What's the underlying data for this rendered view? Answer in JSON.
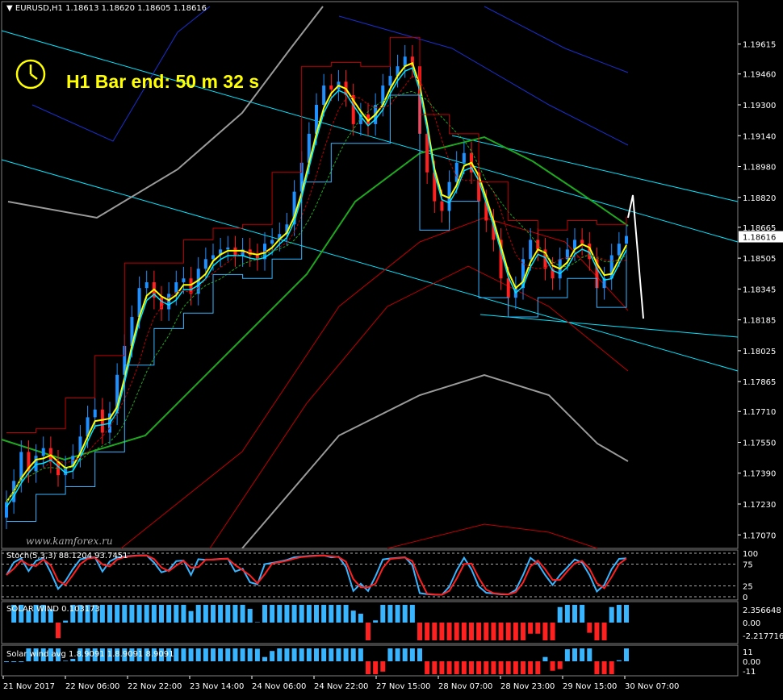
{
  "header": {
    "symbol": "EURUSD,H1",
    "ohlc": "1.18613 1.18620 1.18605 1.18616",
    "timer_text": "H1 Bar end: 50 m 32 s",
    "watermark": "www.kamforex.ru"
  },
  "indicators": {
    "stoch_label": "Stoch(5,3,3) 88.1204 93.7451",
    "solar_label": "SOLAR WIND 0.103173",
    "solar_avg_label": "Solar wind avg 1.8.9091 1.8.9091 8.9091"
  },
  "colors": {
    "background": "#000000",
    "bull_candle": "#1e90ff",
    "bear_candle": "#ff2020",
    "yellow": "#ffff00",
    "cyan": "#00e5ff",
    "green": "#1fa81f",
    "red": "#c00000",
    "gray": "#9a9a9a",
    "navy": "#1a2fcc"
  },
  "chart_data": {
    "type": "line",
    "price_axis": {
      "ticks": [
        "1.19615",
        "1.19460",
        "1.19300",
        "1.19140",
        "1.18980",
        "1.18820",
        "1.18665",
        "1.18505",
        "1.18345",
        "1.18185",
        "1.18025",
        "1.17865",
        "1.17710",
        "1.17550",
        "1.17390",
        "1.17230",
        "1.17070"
      ],
      "current_price": "1.18616",
      "ylim": [
        1.17,
        1.1976
      ]
    },
    "time_axis": {
      "ticks": [
        "21 Nov 2017",
        "22 Nov 06:00",
        "22 Nov 22:00",
        "23 Nov 14:00",
        "24 Nov 06:00",
        "24 Nov 22:00",
        "27 Nov 15:00",
        "28 Nov 07:00",
        "28 Nov 23:00",
        "29 Nov 15:00",
        "30 Nov 07:00"
      ]
    },
    "close_series": [
      1.1724,
      1.1735,
      1.175,
      1.174,
      1.1748,
      1.1752,
      1.1745,
      1.1738,
      1.1742,
      1.1748,
      1.1758,
      1.1768,
      1.1772,
      1.176,
      1.177,
      1.179,
      1.1805,
      1.182,
      1.1835,
      1.1838,
      1.183,
      1.1824,
      1.1832,
      1.1838,
      1.184,
      1.1832,
      1.1845,
      1.185,
      1.1852,
      1.1855,
      1.1856,
      1.1852,
      1.1855,
      1.1852,
      1.185,
      1.1858,
      1.186,
      1.1863,
      1.1868,
      1.1885,
      1.19,
      1.1915,
      1.193,
      1.194,
      1.1938,
      1.1942,
      1.1935,
      1.192,
      1.1925,
      1.192,
      1.193,
      1.194,
      1.1945,
      1.195,
      1.1955,
      1.195,
      1.1915,
      1.1895,
      1.188,
      1.1875,
      1.189,
      1.19,
      1.1905,
      1.1895,
      1.188,
      1.187,
      1.186,
      1.184,
      1.183,
      1.1835,
      1.185,
      1.186,
      1.1855,
      1.1845,
      1.184,
      1.185,
      1.1855,
      1.186,
      1.1858,
      1.185,
      1.1835,
      1.184,
      1.1852,
      1.1858,
      1.1862
    ],
    "stoch": {
      "main": 88.1204,
      "signal": 93.7451,
      "levels": [
        100,
        75,
        25,
        0
      ]
    },
    "solar_wind": {
      "value": 0.103173,
      "ticks": [
        "2.356648",
        "0.00",
        "-2.217716"
      ]
    },
    "solar_wind_avg": {
      "ticks": [
        "11",
        "0.00",
        "-11"
      ]
    }
  }
}
